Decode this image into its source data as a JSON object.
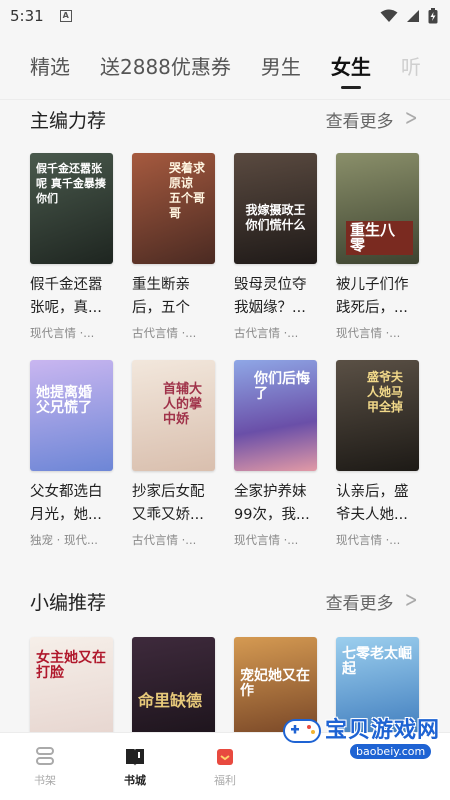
{
  "status_bar": {
    "time": "5:31"
  },
  "tabs": [
    {
      "label": "精选",
      "active": false
    },
    {
      "label": "送2888优惠券",
      "active": false
    },
    {
      "label": "男生",
      "active": false
    },
    {
      "label": "女生",
      "active": true
    },
    {
      "label": "听",
      "active": false
    }
  ],
  "sections": [
    {
      "title": "主编力荐",
      "more_label": "查看更多",
      "books": [
        {
          "title": "假千金还嚣张呢，真...",
          "meta": "现代言情 ·..."
        },
        {
          "title": "重生断亲后，五个哥...",
          "meta": "古代言情 ·..."
        },
        {
          "title": "毁母灵位夺我姻缘？...",
          "meta": "古代言情 ·..."
        },
        {
          "title": "被儿子们作践死后，...",
          "meta": "现代言情 ·..."
        },
        {
          "title": "父女都选白月光，她...",
          "meta": "独宠 · 现代..."
        },
        {
          "title": "抄家后女配又乖又娇...",
          "meta": "古代言情 ·..."
        },
        {
          "title": "全家护养妹99次，我...",
          "meta": "现代言情 ·..."
        },
        {
          "title": "认亲后，盛爷夫人她...",
          "meta": "现代言情 ·..."
        }
      ]
    },
    {
      "title": "小编推荐",
      "more_label": "查看更多",
      "books": []
    }
  ],
  "covers": [
    {
      "text": "假千金还嚣张呢 真千金暴揍你们",
      "bg": "#2f3c33"
    },
    {
      "text": "哭着求原谅 五个哥哥",
      "bg": "#6b3a2a"
    },
    {
      "text": "我嫁摄政王 你们慌什么",
      "bg": "#3a2f2b"
    },
    {
      "text": "重生八零",
      "bg": "#5f6b4a"
    },
    {
      "text": "她提离婚 父兄慌了",
      "bg": "#7a8fd1"
    },
    {
      "text": "首辅大人的掌中娇",
      "bg": "#e8d7c6"
    },
    {
      "text": "你们后悔了",
      "bg": "#6b5fae"
    },
    {
      "text": "盛爷夫人她马甲全掉",
      "bg": "#3a3730"
    },
    {
      "text": "女主她又在打脸",
      "bg": "#f1e6e3"
    },
    {
      "text": "命里缺德",
      "bg": "#2b1f2a"
    },
    {
      "text": "宠妃她又在作",
      "bg": "#b37d3c"
    },
    {
      "text": "七零老太崛起",
      "bg": "#3d7fbf"
    }
  ],
  "bottom_nav": [
    {
      "label": "书架",
      "icon": "bookshelf-icon",
      "active": false
    },
    {
      "label": "书城",
      "icon": "bookstore-icon",
      "active": true
    },
    {
      "label": "福利",
      "icon": "gift-icon",
      "active": false
    }
  ],
  "watermark": {
    "text": "宝贝游戏网",
    "url": "baobeiy.com"
  },
  "colors": {
    "accent": "#222222",
    "watermark": "#1e63d3",
    "welfare": "#e84a3f"
  }
}
